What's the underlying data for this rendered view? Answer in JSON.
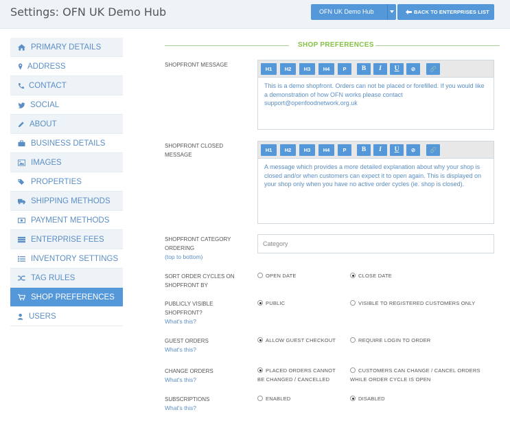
{
  "header": {
    "title": "Settings: OFN UK Demo Hub",
    "hub_select_value": "OFN UK Demo Hub",
    "back_label": "BACK TO ENTERPRISES LIST"
  },
  "sidebar": {
    "items": [
      {
        "label": "PRIMARY DETAILS",
        "icon": "home-icon"
      },
      {
        "label": "ADDRESS",
        "icon": "map-marker-icon"
      },
      {
        "label": "CONTACT",
        "icon": "phone-icon"
      },
      {
        "label": "SOCIAL",
        "icon": "twitter-icon"
      },
      {
        "label": "ABOUT",
        "icon": "pencil-icon"
      },
      {
        "label": "BUSINESS DETAILS",
        "icon": "briefcase-icon"
      },
      {
        "label": "IMAGES",
        "icon": "picture-icon"
      },
      {
        "label": "PROPERTIES",
        "icon": "tags-icon"
      },
      {
        "label": "SHIPPING METHODS",
        "icon": "truck-icon"
      },
      {
        "label": "PAYMENT METHODS",
        "icon": "money-icon"
      },
      {
        "label": "ENTERPRISE FEES",
        "icon": "tasks-icon"
      },
      {
        "label": "INVENTORY SETTINGS",
        "icon": "list-icon"
      },
      {
        "label": "TAG RULES",
        "icon": "random-icon"
      },
      {
        "label": "SHOP PREFERENCES",
        "icon": "shopping-cart-icon"
      },
      {
        "label": "USERS",
        "icon": "user-icon"
      }
    ],
    "active": "SHOP PREFERENCES"
  },
  "main": {
    "section_title": "SHOP PREFERENCES",
    "toolbar_buttons": [
      "H1",
      "H2",
      "H3",
      "H4",
      "P",
      "B",
      "I",
      "U",
      "⊘",
      "🔗"
    ],
    "shopfront_message": {
      "label": "SHOPFRONT MESSAGE",
      "text": "This is a demo shopfront. Orders can not be placed or forefilled. If you would like a demonstration of how OFN works please contact support@openfoodnetwork.org.uk"
    },
    "shopfront_closed_message": {
      "label_line1": "SHOPFRONT CLOSED",
      "label_line2": "MESSAGE",
      "text": "A message which provides a more detailed explanation about why your shop is closed and/or when customers can expect it to open again. This is displayed on your shop only when you have no active order cycles (ie. shop is closed)."
    },
    "category_ordering": {
      "label_line1": "SHOPFRONT CATEGORY",
      "label_line2": "ORDERING",
      "label_line3": "(top to bottom)",
      "placeholder": "Category"
    },
    "sort_order_cycles": {
      "label_line1": "SORT ORDER CYCLES ON",
      "label_line2": "SHOPFRONT BY",
      "option1": "OPEN DATE",
      "option2": "CLOSE DATE",
      "selected": "CLOSE DATE"
    },
    "publicly_visible": {
      "label_line1": "PUBLICLY VISIBLE",
      "label_line2": "SHOPFRONT?",
      "help": "What's this?",
      "option1": "PUBLIC",
      "option2": "VISIBLE TO REGISTERED CUSTOMERS ONLY",
      "selected": "PUBLIC"
    },
    "guest_orders": {
      "label": "GUEST ORDERS",
      "help": "What's this?",
      "option1": "ALLOW GUEST CHECKOUT",
      "option2": "REQUIRE LOGIN TO ORDER",
      "selected": "ALLOW GUEST CHECKOUT"
    },
    "change_orders": {
      "label": "CHANGE ORDERS",
      "help": "What's this?",
      "option1_line1": "PLACED ORDERS CANNOT",
      "option1_line2": "BE CHANGED / CANCELLED",
      "option2_line1": "CUSTOMERS CAN CHANGE / CANCEL ORDERS",
      "option2_line2": "WHILE ORDER CYCLE IS OPEN",
      "selected": "PLACED ORDERS CANNOT BE CHANGED / CANCELLED"
    },
    "subscriptions": {
      "label": "SUBSCRIPTIONS",
      "help": "What's this?",
      "option1": "ENABLED",
      "option2": "DISABLED",
      "selected": "DISABLED"
    }
  },
  "colors": {
    "accent": "#5498da",
    "section_green": "#86c047",
    "link_blue": "#5b8ec4"
  }
}
